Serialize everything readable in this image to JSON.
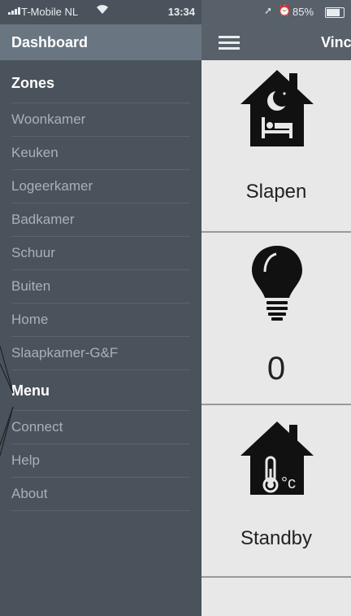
{
  "status_bar": {
    "carrier": "T-Mobile NL",
    "time": "13:34",
    "battery": "85%"
  },
  "drawer": {
    "title": "Dashboard",
    "zones_heading": "Zones",
    "zones": [
      "Woonkamer",
      "Keuken",
      "Logeerkamer",
      "Badkamer",
      "Schuur",
      "Buiten",
      "Home",
      "Slaapkamer-G&F"
    ],
    "menu_heading": "Menu",
    "menu": [
      "Connect",
      "Help",
      "About"
    ]
  },
  "main": {
    "title": "Vinc",
    "tiles": [
      {
        "label": "Slapen",
        "icon": "house-sleep-icon"
      },
      {
        "label": "0",
        "icon": "lightbulb-icon"
      },
      {
        "label": "Standby",
        "icon": "house-thermometer-icon"
      }
    ]
  },
  "colors": {
    "drawer_bg": "#4a535c",
    "drawer_header_bg": "#697682",
    "appbar_bg": "#58606a",
    "tile_bg": "#e8e8e8"
  }
}
